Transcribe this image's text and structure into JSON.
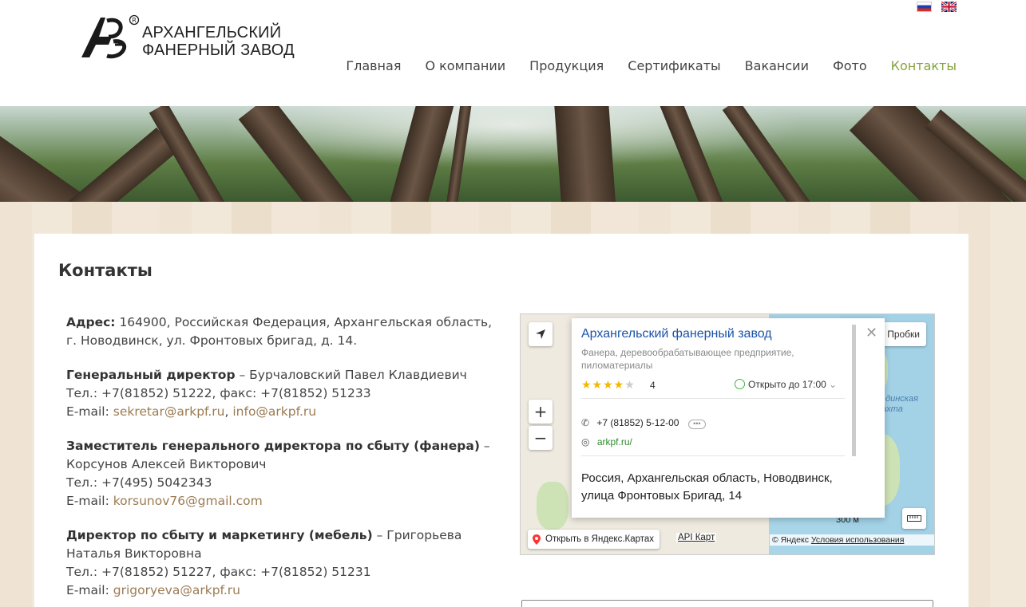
{
  "brand": {
    "name_line1": "АРХАНГЕЛЬСКИЙ",
    "name_line2": "ФАНЕРНЫЙ ЗАВОД",
    "registered_mark": "®",
    "logo_icon": "apz-monogram-icon"
  },
  "languages": [
    {
      "code": "ru",
      "icon": "flag-russia-icon"
    },
    {
      "code": "en",
      "icon": "flag-uk-icon"
    }
  ],
  "nav": {
    "items": [
      {
        "label": "Главная",
        "active": false
      },
      {
        "label": "О компании",
        "active": false
      },
      {
        "label": "Продукция",
        "active": false
      },
      {
        "label": "Сертификаты",
        "active": false
      },
      {
        "label": "Вакансии",
        "active": false
      },
      {
        "label": "Фото",
        "active": false
      },
      {
        "label": "Контакты",
        "active": true
      }
    ]
  },
  "colors": {
    "accent": "#86a340",
    "link": "#9b7b52",
    "map_title": "#1a53a8"
  },
  "page": {
    "title": "Контакты"
  },
  "contacts": {
    "address": {
      "label": "Адрес:",
      "text": " 164900, Российская Федерация, Архангельская область, г. Новодвинск, ул. Фронтовых бригад, д. 14."
    },
    "ceo": {
      "role": "Генеральный директор",
      "name": " – Бурчаловский Павел Клавдиевич",
      "phone": "Тел.: +7(81852) 51222, факс: +7(81852) 51233",
      "email_label": "E-mail: ",
      "email1": "sekretar@arkpf.ru",
      "email_sep": ", ",
      "email2": "info@arkpf.ru"
    },
    "deputy": {
      "role": "Заместитель генерального директора по сбыту (фанера)",
      "name": " – Корсунов Алексей Викторович",
      "phone": "Тел.: +7(495) 5042343",
      "email_label": "E-mail: ",
      "email": "korsunov76@gmail.com"
    },
    "sales": {
      "role": "Директор по сбыту и маркетингу (мебель)",
      "name": " – Григорьева Наталья Викторовна",
      "phone": "Тел.: +7(81852) 51227, факс: +7(81852) 51231",
      "email_label": "E-mail: ",
      "email": "grigoryeva@arkpf.ru"
    }
  },
  "map": {
    "popup": {
      "title": "Архангельский фанерный завод",
      "subtitle": "Фанера, деревообрабатывающее предприятие, пиломатериалы",
      "rating": "4",
      "stars_filled": 4,
      "stars_total": 5,
      "hours": "Открыто до 17:00",
      "phone": "+7 (81852) 5-12-00",
      "more": "•••",
      "site": "arkpf.ru/",
      "address": "Россия, Архангельская область, Новодвинск, улица Фронтовых Бригад, 14"
    },
    "traffic_label": "Пробки",
    "open_in_yandex": "Открыть в Яндекс.Картах",
    "api_link": "API Карт",
    "copyright": "© Яндекс ",
    "terms": "Условия использования",
    "scale": "300 м",
    "river_label": "…динская\nпахта",
    "zoom_in": "+",
    "zoom_out": "−"
  }
}
